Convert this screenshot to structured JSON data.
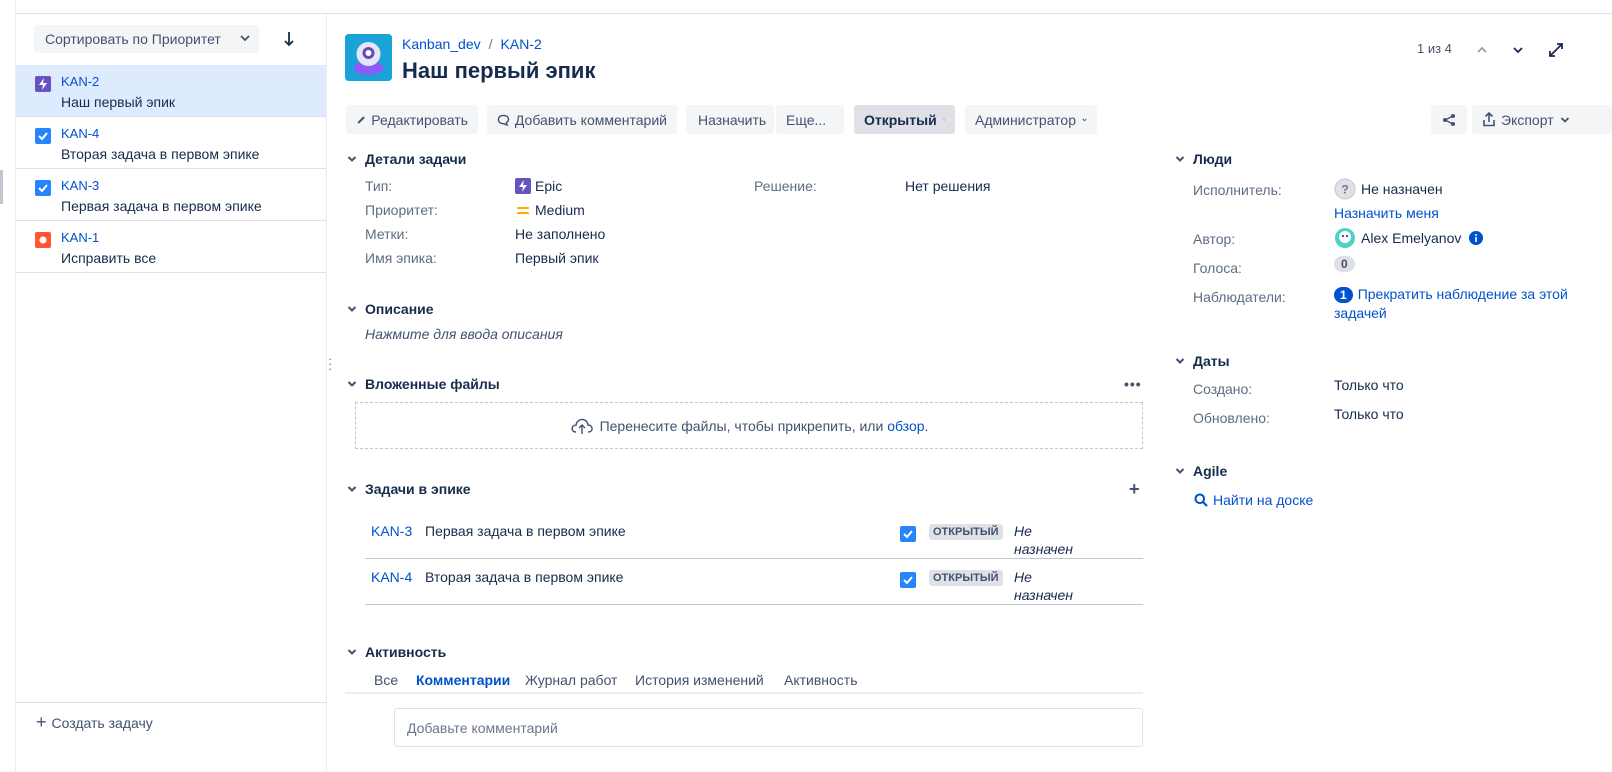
{
  "sidebar": {
    "sort_label": "Сортировать по Приоритет",
    "items": [
      {
        "key": "KAN-2",
        "summary": "Наш первый эпик",
        "type": "epic"
      },
      {
        "key": "KAN-4",
        "summary": "Вторая задача в первом эпике",
        "type": "task"
      },
      {
        "key": "KAN-3",
        "summary": "Первая задача в первом эпике",
        "type": "task"
      },
      {
        "key": "KAN-1",
        "summary": "Исправить все",
        "type": "bug"
      }
    ],
    "create_label": "Создать задачу"
  },
  "header": {
    "project": "Kanban_dev",
    "issue_key": "KAN-2",
    "title": "Наш первый эпик",
    "pager": "1 из 4"
  },
  "toolbar": {
    "edit": "Редактировать",
    "comment": "Добавить комментарий",
    "assign": "Назначить",
    "more": "Еще...",
    "status": "Открытый",
    "admin": "Администратор",
    "export": "Экспорт"
  },
  "details": {
    "heading": "Детали задачи",
    "type_label": "Тип:",
    "type_value": "Epic",
    "priority_label": "Приоритет:",
    "priority_value": "Medium",
    "labels_label": "Метки:",
    "labels_value": "Не заполнено",
    "epic_name_label": "Имя эпика:",
    "epic_name_value": "Первый эпик",
    "resolution_label": "Решение:",
    "resolution_value": "Нет решения"
  },
  "description": {
    "heading": "Описание",
    "placeholder": "Нажмите для ввода описания"
  },
  "attachments": {
    "heading": "Вложенные файлы",
    "drop_text": "Перенесите файлы, чтобы прикрепить, или",
    "browse": "обзор",
    "period": "."
  },
  "epic_tasks": {
    "heading": "Задачи в эпике",
    "rows": [
      {
        "key": "KAN-3",
        "summary": "Первая задача в первом эпике",
        "status": "ОТКРЫТЫЙ",
        "assignee": "Не назначен"
      },
      {
        "key": "KAN-4",
        "summary": "Вторая задача в первом эпике",
        "status": "ОТКРЫТЫЙ",
        "assignee": "Не назначен"
      }
    ]
  },
  "activity": {
    "heading": "Активность",
    "tabs": [
      "Все",
      "Комментарии",
      "Журнал работ",
      "История изменений",
      "Активность"
    ],
    "active_tab": "Комментарии",
    "comment_placeholder": "Добавьте комментарий"
  },
  "people": {
    "heading": "Люди",
    "assignee_label": "Исполнитель:",
    "assignee_value": "Не назначен",
    "assign_me": "Назначить меня",
    "author_label": "Автор:",
    "author_value": "Alex Emelyanov",
    "votes_label": "Голоса:",
    "votes_value": "0",
    "watchers_label": "Наблюдатели:",
    "watchers_count": "1",
    "watchers_action": "Прекратить наблюдение за этой задачей"
  },
  "dates": {
    "heading": "Даты",
    "created_label": "Создано:",
    "created_value": "Только что",
    "updated_label": "Обновлено:",
    "updated_value": "Только что"
  },
  "agile": {
    "heading": "Agile",
    "find_on_board": "Найти на доске"
  },
  "colors": {
    "link": "#0052cc",
    "epic": "#6554c0",
    "task": "#2684ff",
    "bug": "#ff5630",
    "priority_medium": "#ffab00",
    "selected_row": "#deebff"
  }
}
